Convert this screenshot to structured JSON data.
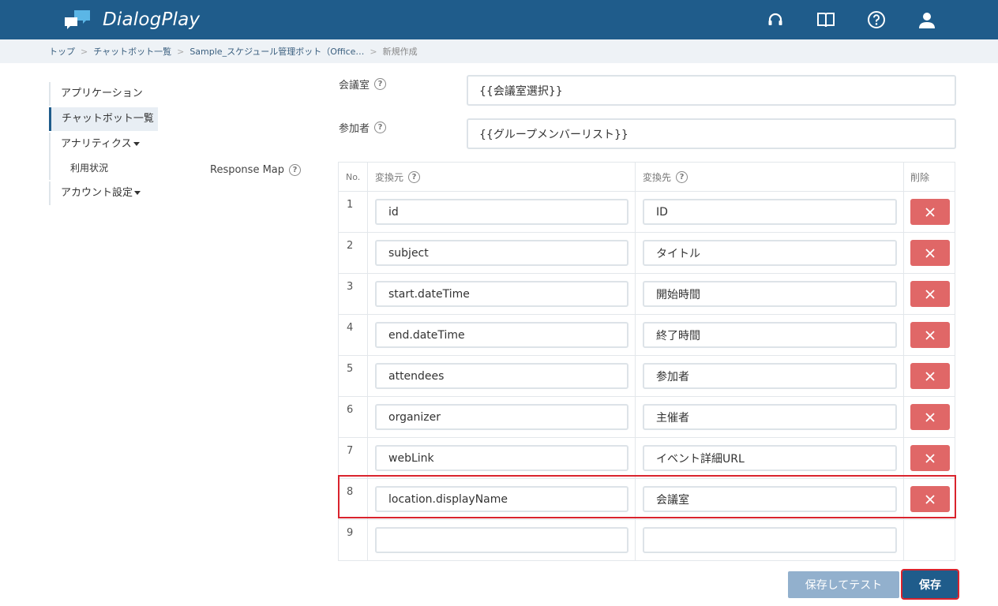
{
  "app": {
    "title": "DialogPlay"
  },
  "header_icons": [
    "headset-icon",
    "book-icon",
    "help-icon",
    "user-icon"
  ],
  "breadcrumb": [
    "トップ",
    "チャットボット一覧",
    "Sample_スケジュール管理ボット（Office…",
    "新規作成"
  ],
  "sidebar": {
    "items": [
      {
        "label": "アプリケーション"
      },
      {
        "label": "チャットボット一覧"
      },
      {
        "label": "アナリティクス"
      },
      {
        "label": "利用状況"
      },
      {
        "label": "アカウント設定"
      }
    ]
  },
  "form": {
    "meeting_room_label": "会議室",
    "meeting_room_value": "{{会議室選択}}",
    "attendees_label": "参加者",
    "attendees_value": "{{グループメンバーリスト}}",
    "response_map_label": "Response Map"
  },
  "table": {
    "headers": {
      "no": "No.",
      "source": "変換元",
      "target": "変換先",
      "delete": "削除"
    },
    "rows": [
      {
        "no": "1",
        "source": "id",
        "target": "ID"
      },
      {
        "no": "2",
        "source": "subject",
        "target": "タイトル"
      },
      {
        "no": "3",
        "source": "start.dateTime",
        "target": "開始時間"
      },
      {
        "no": "4",
        "source": "end.dateTime",
        "target": "終了時間"
      },
      {
        "no": "5",
        "source": "attendees",
        "target": "参加者"
      },
      {
        "no": "6",
        "source": "organizer",
        "target": "主催者"
      },
      {
        "no": "7",
        "source": "webLink",
        "target": "イベント詳細URL"
      },
      {
        "no": "8",
        "source": "location.displayName",
        "target": "会議室"
      },
      {
        "no": "9",
        "source": "",
        "target": ""
      }
    ]
  },
  "buttons": {
    "save_and_test": "保存してテスト",
    "save": "保存"
  },
  "colors": {
    "header": "#1f5c8b",
    "delete": "#e06767",
    "highlight": "#d9232d",
    "accent_light": "#5bb6e6"
  }
}
